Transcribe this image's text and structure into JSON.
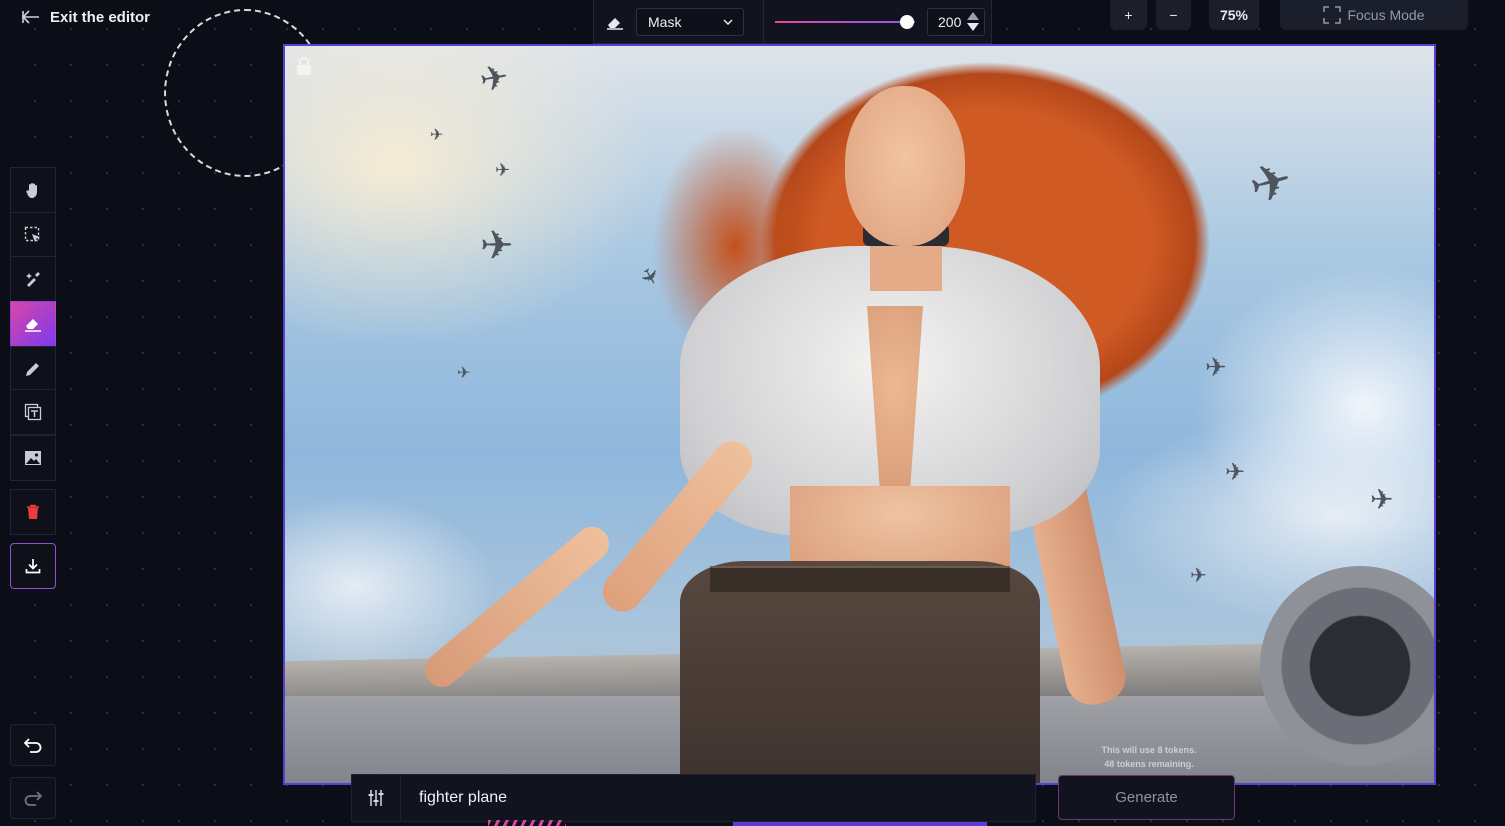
{
  "header": {
    "exit_label": "Exit the editor"
  },
  "brush_toolbar": {
    "mode_value": "Mask",
    "brush_size": "200",
    "brush_size_level": 1.0
  },
  "view_controls": {
    "zoom_in": "+",
    "zoom_out": "−",
    "zoom_level": "75%",
    "focus_mode_label": "Focus Mode"
  },
  "tools": [
    {
      "name": "pan",
      "icon": "hand-icon"
    },
    {
      "name": "select",
      "icon": "selection-cursor-icon"
    },
    {
      "name": "inpaint",
      "icon": "magic-brush-icon"
    },
    {
      "name": "eraser",
      "icon": "eraser-icon",
      "active": true
    },
    {
      "name": "draw",
      "icon": "pencil-icon"
    },
    {
      "name": "text",
      "icon": "text-layer-icon"
    },
    {
      "name": "image",
      "icon": "image-icon"
    },
    {
      "name": "delete",
      "icon": "trash-icon"
    },
    {
      "name": "download",
      "icon": "download-icon"
    }
  ],
  "prompt": {
    "value": "fighter plane"
  },
  "tokens": {
    "usage_note": "This will use 8 tokens.",
    "remaining": "48 tokens remaining."
  },
  "generate": {
    "label": "Generate"
  },
  "colors": {
    "accent": "#5b3fd4",
    "active_tool_start": "#d946a8",
    "active_tool_end": "#7c3aed",
    "background": "#0b0d17"
  }
}
